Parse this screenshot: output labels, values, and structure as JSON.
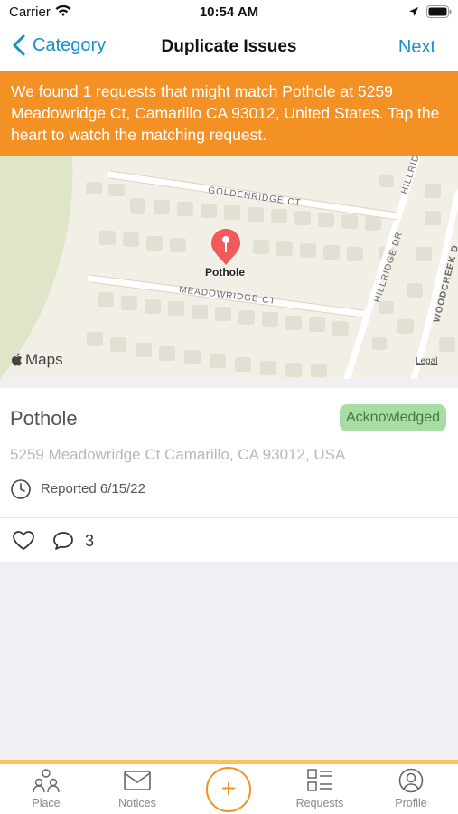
{
  "status_bar": {
    "carrier": "Carrier",
    "time": "10:54 AM"
  },
  "nav": {
    "back_label": "Category",
    "title": "Duplicate Issues",
    "next_label": "Next"
  },
  "banner": {
    "text": "We found 1 requests that might match Pothole at 5259 Meadowridge Ct, Camarillo CA 93012, United States. Tap the heart to watch the matching request."
  },
  "map": {
    "pin_label": "Pothole",
    "streets": [
      "GOLDENRIDGE CT",
      "MEADOWRIDGE CT",
      "HILLRIDGE DR",
      "HILLRID",
      "WOODCREEK D"
    ],
    "attribution": "Maps",
    "legal": "Legal"
  },
  "issue": {
    "title": "Pothole",
    "status": "Acknowledged",
    "address": "5259 Meadowridge Ct Camarillo, CA 93012, USA",
    "reported": "Reported 6/15/22",
    "comment_count": "3"
  },
  "tab_bar": {
    "tabs": [
      {
        "label": "Place",
        "icon": "place-icon"
      },
      {
        "label": "Notices",
        "icon": "mail-icon"
      },
      {
        "label": "+",
        "icon": "add-icon"
      },
      {
        "label": "Requests",
        "icon": "list-icon"
      },
      {
        "label": "Profile",
        "icon": "user-icon"
      }
    ]
  },
  "colors": {
    "accent_blue": "#1a8fc9",
    "brand_orange": "#f39125",
    "status_green": "#a8dca5",
    "tab_bar_border": "#f8c35a"
  }
}
